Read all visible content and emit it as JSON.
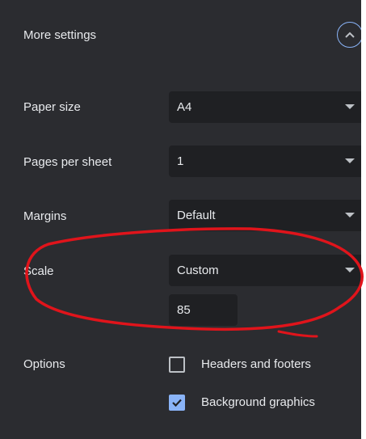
{
  "more_settings": {
    "title": "More settings",
    "toggle_icon": "chevron-up-icon"
  },
  "settings": {
    "paper_size": {
      "label": "Paper size",
      "value": "A4"
    },
    "pages_per_sheet": {
      "label": "Pages per sheet",
      "value": "1"
    },
    "margins": {
      "label": "Margins",
      "value": "Default"
    },
    "scale": {
      "label": "Scale",
      "value": "Custom",
      "custom_value": "85"
    }
  },
  "options": {
    "label": "Options",
    "items": [
      {
        "label": "Headers and footers",
        "checked": false
      },
      {
        "label": "Background graphics",
        "checked": true
      }
    ]
  },
  "colors": {
    "accent": "#8ab4f8",
    "annotation": "#e0141b",
    "panel_bg": "#2b2c30",
    "field_bg": "#1f2023"
  }
}
